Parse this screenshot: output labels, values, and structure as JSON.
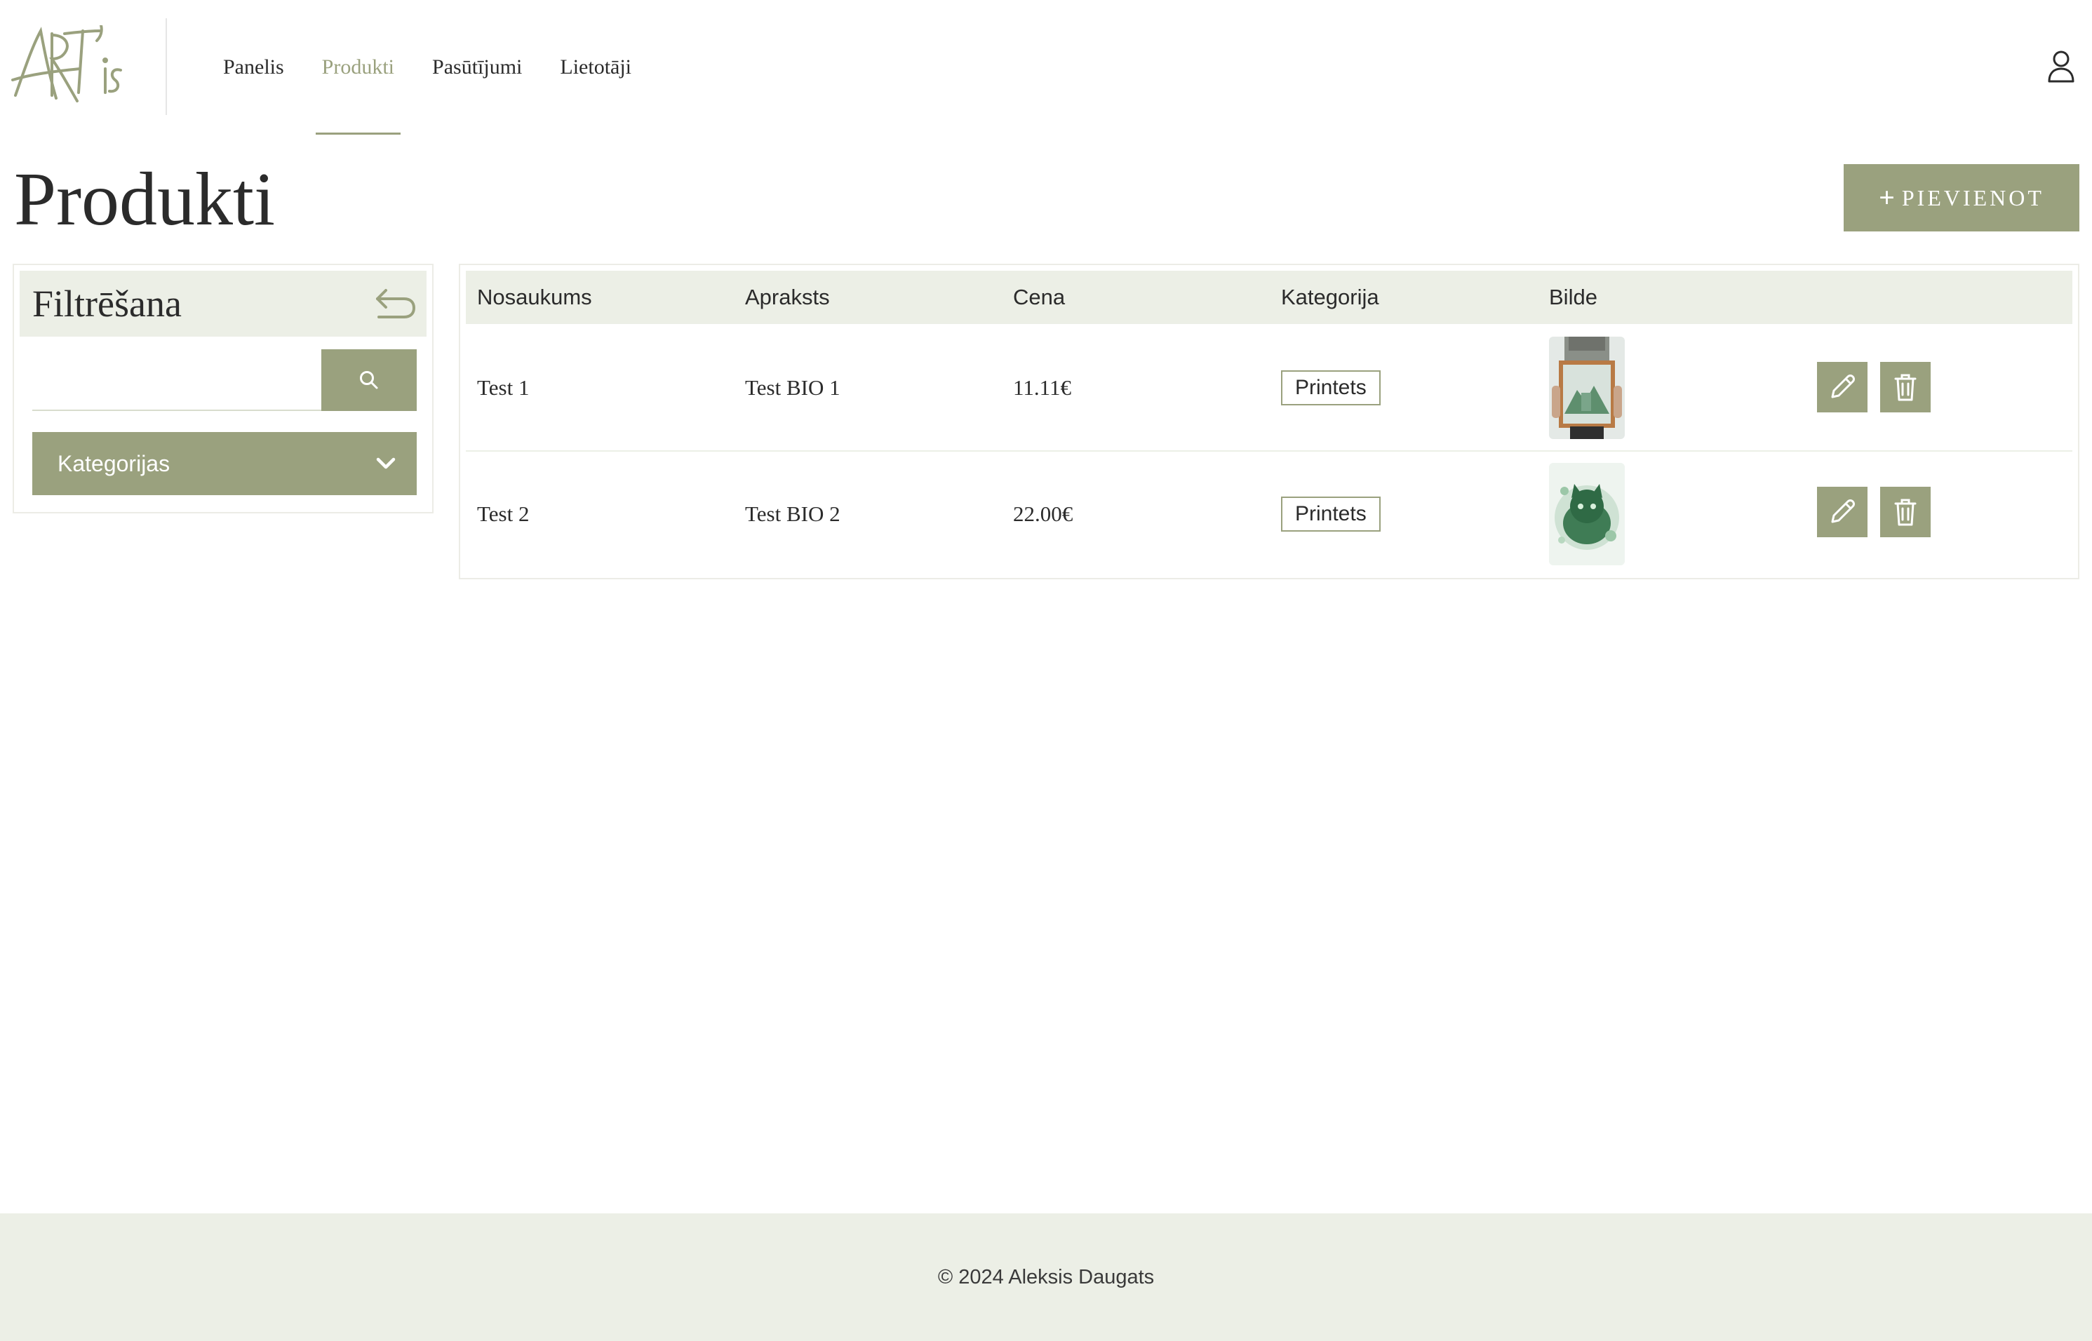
{
  "brand": {
    "logo_text": "ART'is"
  },
  "nav": {
    "items": [
      {
        "label": "Panelis",
        "active": false
      },
      {
        "label": "Produkti",
        "active": true
      },
      {
        "label": "Pasūtījumi",
        "active": false
      },
      {
        "label": "Lietotāji",
        "active": false
      }
    ]
  },
  "page": {
    "title": "Produkti",
    "add_button_plus": "+",
    "add_button_label": "PIEVIENOT"
  },
  "filter": {
    "title": "Filtrēšana",
    "search_value": "",
    "search_placeholder": "",
    "category_label": "Kategorijas"
  },
  "table": {
    "headers": [
      "Nosaukums",
      "Apraksts",
      "Cena",
      "Kategorija",
      "Bilde",
      ""
    ],
    "rows": [
      {
        "name": "Test 1",
        "description": "Test BIO 1",
        "price": "11.11€",
        "category": "Printets",
        "image": "poster-held-by-person"
      },
      {
        "name": "Test 2",
        "description": "Test BIO 2",
        "price": "22.00€",
        "category": "Printets",
        "image": "green-cat-watercolor"
      }
    ]
  },
  "footer": {
    "copyright": "© 2024 Aleksis Daugats"
  },
  "colors": {
    "accent": "#9aa17e",
    "panel_bg": "#ecefe6",
    "text": "#2b2b2b"
  },
  "icons": {
    "user": "user-icon",
    "reset": "undo-arrow-icon",
    "search": "search-icon",
    "chevron": "chevron-down-icon",
    "edit": "pencil-icon",
    "delete": "trash-icon"
  }
}
